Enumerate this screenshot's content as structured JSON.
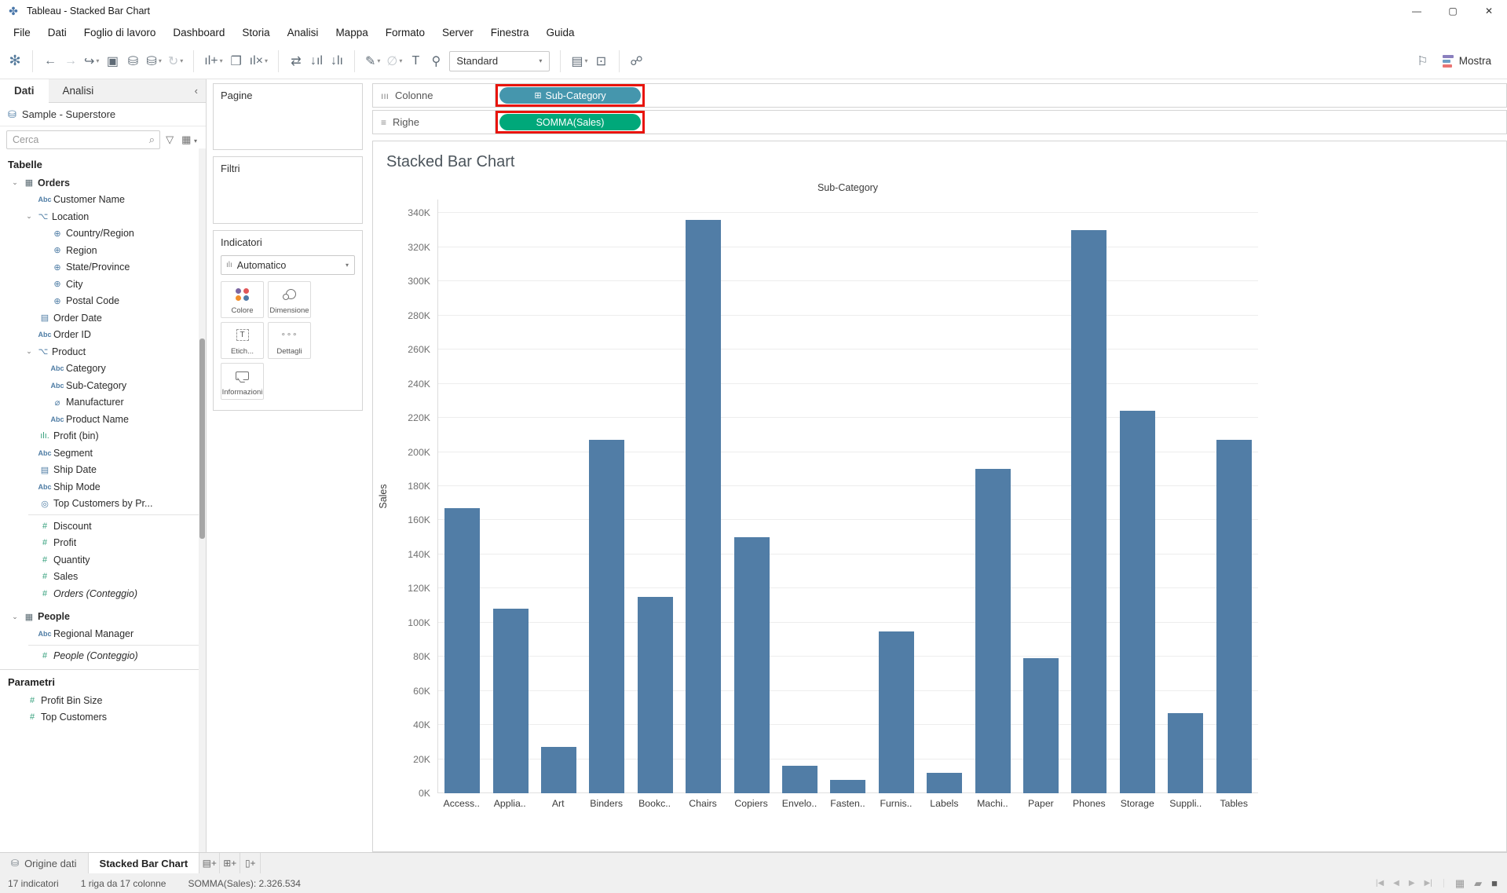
{
  "window": {
    "title": "Tableau - Stacked Bar Chart",
    "controls": [
      "minimize",
      "maximize",
      "close"
    ]
  },
  "menu": {
    "items": [
      "File",
      "Dati",
      "Foglio di lavoro",
      "Dashboard",
      "Storia",
      "Analisi",
      "Mappa",
      "Formato",
      "Server",
      "Finestra",
      "Guida"
    ]
  },
  "toolbar": {
    "items": [
      {
        "name": "tableau-logo",
        "logo": true
      },
      {
        "divider": true
      },
      {
        "name": "back"
      },
      {
        "name": "forward",
        "disabled": true
      },
      {
        "name": "redo",
        "caret": true
      },
      {
        "name": "save"
      },
      {
        "name": "add-datasource"
      },
      {
        "name": "pause-datasource",
        "caret": true
      },
      {
        "name": "refresh",
        "disabled": true,
        "caret": true
      },
      {
        "divider": true
      },
      {
        "name": "new-worksheet",
        "caret": true
      },
      {
        "name": "duplicate"
      },
      {
        "name": "clear-sheet",
        "caret": true
      },
      {
        "divider": true
      },
      {
        "name": "swap-axes"
      },
      {
        "name": "sort-ascending"
      },
      {
        "name": "sort-descending"
      },
      {
        "divider": true
      },
      {
        "name": "highlight",
        "caret": true
      },
      {
        "name": "attach",
        "disabled": true,
        "caret": true
      },
      {
        "name": "text-label"
      },
      {
        "name": "pin"
      },
      {
        "fit_select": true
      },
      {
        "divider": true
      },
      {
        "name": "show-cards",
        "caret": true
      },
      {
        "name": "presentation"
      },
      {
        "divider": true
      },
      {
        "name": "share"
      }
    ],
    "fit_selector": "Standard",
    "show_me_label": "Mostra"
  },
  "sidebar": {
    "tabs": [
      {
        "label": "Dati",
        "active": true
      },
      {
        "label": "Analisi",
        "active": false
      }
    ],
    "datasource": "Sample - Superstore",
    "search_placeholder": "Cerca",
    "tables_header": "Tabelle",
    "fields": [
      {
        "icon": "table",
        "color": "dark",
        "label": "Orders",
        "bold": true,
        "indent": 0,
        "expander": true
      },
      {
        "icon": "abc",
        "color": "blue",
        "label": "Customer Name",
        "indent": 2
      },
      {
        "icon": "hierarchy",
        "color": "blue",
        "label": "Location",
        "indent": 1,
        "expander": true
      },
      {
        "icon": "globe",
        "color": "blue",
        "label": "Country/Region",
        "indent": 3
      },
      {
        "icon": "globe",
        "color": "blue",
        "label": "Region",
        "indent": 3
      },
      {
        "icon": "globe",
        "color": "blue",
        "label": "State/Province",
        "indent": 3
      },
      {
        "icon": "globe",
        "color": "blue",
        "label": "City",
        "indent": 3
      },
      {
        "icon": "globe",
        "color": "blue",
        "label": "Postal Code",
        "indent": 3
      },
      {
        "icon": "calendar",
        "color": "blue",
        "label": "Order Date",
        "indent": 2
      },
      {
        "icon": "abc",
        "color": "blue",
        "label": "Order ID",
        "indent": 2
      },
      {
        "icon": "hierarchy",
        "color": "blue",
        "label": "Product",
        "indent": 1,
        "expander": true
      },
      {
        "icon": "abc",
        "color": "blue",
        "label": "Category",
        "indent": 3
      },
      {
        "icon": "abc",
        "color": "blue",
        "label": "Sub-Category",
        "indent": 3
      },
      {
        "icon": "paperclip",
        "color": "blue",
        "label": "Manufacturer",
        "indent": 3
      },
      {
        "icon": "abc",
        "color": "blue",
        "label": "Product Name",
        "indent": 3
      },
      {
        "icon": "histogram",
        "color": "green",
        "label": "Profit (bin)",
        "indent": 2
      },
      {
        "icon": "abc",
        "color": "blue",
        "label": "Segment",
        "indent": 2
      },
      {
        "icon": "calendar",
        "color": "blue",
        "label": "Ship Date",
        "indent": 2
      },
      {
        "icon": "abc",
        "color": "blue",
        "label": "Ship Mode",
        "indent": 2
      },
      {
        "icon": "set",
        "color": "blue",
        "label": "Top Customers by Pr...",
        "indent": 2,
        "divider_after": true
      },
      {
        "icon": "hash",
        "color": "green",
        "label": "Discount",
        "indent": 2
      },
      {
        "icon": "hash",
        "color": "green",
        "label": "Profit",
        "indent": 2
      },
      {
        "icon": "hash",
        "color": "green",
        "label": "Quantity",
        "indent": 2
      },
      {
        "icon": "hash",
        "color": "green",
        "label": "Sales",
        "indent": 2
      },
      {
        "icon": "hash",
        "color": "green",
        "label": "Orders (Conteggio)",
        "indent": 2,
        "italic": true,
        "gap_after": true
      },
      {
        "icon": "table",
        "color": "dark",
        "label": "People",
        "bold": true,
        "indent": 0,
        "expander": true
      },
      {
        "icon": "abc",
        "color": "blue",
        "label": "Regional Manager",
        "indent": 2,
        "divider_after": true
      },
      {
        "icon": "hash",
        "color": "green",
        "label": "People (Conteggio)",
        "indent": 2,
        "italic": true
      }
    ],
    "parameters_header": "Parametri",
    "parameters": [
      {
        "icon": "hash",
        "color": "green",
        "label": "Profit Bin Size",
        "indent": 1
      },
      {
        "icon": "hash",
        "color": "green",
        "label": "Top Customers",
        "indent": 1
      }
    ]
  },
  "cards": {
    "pages_label": "Pagine",
    "filters_label": "Filtri",
    "marks_label": "Indicatori",
    "mark_type": "Automatico",
    "buttons": [
      {
        "icon": "color",
        "label": "Colore"
      },
      {
        "icon": "size",
        "label": "Dimensione"
      },
      {
        "icon": "label",
        "label": "Etich..."
      },
      {
        "icon": "detail",
        "label": "Dettagli"
      },
      {
        "icon": "tooltip",
        "label": "Informazioni"
      }
    ],
    "color_dots": [
      "#7b66a2",
      "#e15759",
      "#f28e2b",
      "#4e79a7"
    ]
  },
  "shelves": {
    "columns_label": "Colonne",
    "rows_label": "Righe",
    "columns_pill": {
      "text": "Sub-Category",
      "annotated": true
    },
    "rows_pill": {
      "text": "SOMMA(Sales)",
      "annotated": true
    }
  },
  "sheet": {
    "title": "Stacked Bar Chart"
  },
  "chart_data": {
    "type": "bar",
    "title": "Stacked Bar Chart",
    "column_header": "Sub-Category",
    "ylabel": "Sales",
    "xlabel": "",
    "categories": [
      "Access..",
      "Applia..",
      "Art",
      "Binders",
      "Bookc..",
      "Chairs",
      "Copiers",
      "Envelo..",
      "Fasten..",
      "Furnis..",
      "Labels",
      "Machi..",
      "Paper",
      "Phones",
      "Storage",
      "Suppli..",
      "Tables"
    ],
    "values_thousands": [
      167,
      108,
      27,
      207,
      115,
      336,
      150,
      16,
      8,
      95,
      12,
      190,
      79,
      330,
      224,
      47,
      207
    ],
    "y_ticks": [
      "0K",
      "20K",
      "40K",
      "60K",
      "80K",
      "100K",
      "120K",
      "140K",
      "160K",
      "180K",
      "200K",
      "220K",
      "240K",
      "260K",
      "280K",
      "300K",
      "320K",
      "340K"
    ],
    "y_tick_step": 20,
    "ylim": [
      0,
      348
    ],
    "grid": true,
    "legend": false,
    "bar_color": "#517da6",
    "total_sum_shown": "2.326.534"
  },
  "footer": {
    "tabs": [
      {
        "label": "Origine dati",
        "icon": "database",
        "active": false
      },
      {
        "label": "Stacked Bar Chart",
        "active": true
      }
    ],
    "new_buttons": [
      "new-worksheet-tab",
      "new-dashboard-tab",
      "new-story-tab"
    ],
    "status": {
      "marks": "17 indicatori",
      "rows": "1 riga da 17 colonne",
      "sum": "SOMMA(Sales): 2.326.534"
    },
    "nav_icons": [
      "nav-first",
      "nav-prev",
      "nav-next",
      "nav-last"
    ],
    "view_icons": [
      "view-grid",
      "view-filmstrip",
      "view-full"
    ]
  },
  "colors": {
    "dimension_pill": "#4596ad",
    "measure_pill": "#00a87a",
    "annotation_red": "#e8140c",
    "bar": "#517da6"
  }
}
